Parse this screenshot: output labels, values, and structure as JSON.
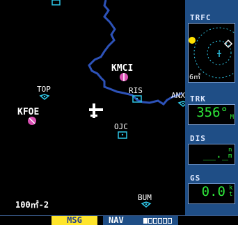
{
  "map": {
    "waypoints": [
      {
        "id": "KMCI",
        "kind": "airport"
      },
      {
        "id": "KFOE",
        "kind": "airport"
      },
      {
        "id": "TOP",
        "kind": "vor"
      },
      {
        "id": "RIS",
        "kind": "vor"
      },
      {
        "id": "ANX",
        "kind": "vor"
      },
      {
        "id": "OJC",
        "kind": "vor"
      },
      {
        "id": "BUM",
        "kind": "vor"
      }
    ],
    "scale_text": "100㎡-2",
    "river_color": "#2d52b8",
    "aircraft_icon": "aircraft-icon"
  },
  "side_panel": {
    "trfc": {
      "title": "TRFC",
      "range_label": "6㎡"
    },
    "trk": {
      "title": "TRK",
      "value": "356°",
      "unit": "M"
    },
    "dis": {
      "title": "DIS",
      "value": "__._",
      "unit": "nm"
    },
    "gs": {
      "title": "GS",
      "value": "0.0",
      "unit": "kt"
    }
  },
  "status_bar": {
    "msg": "MSG",
    "nav": "NAV",
    "signal_segments": [
      true,
      false,
      false,
      false,
      false,
      false
    ]
  },
  "colors": {
    "panel_bg": "#1f4e86",
    "readout_green": "#2ee63a",
    "msg_bg": "#ffe52b",
    "airport_magenta": "#d94fb3",
    "traffic_yellow": "#ffe100"
  }
}
